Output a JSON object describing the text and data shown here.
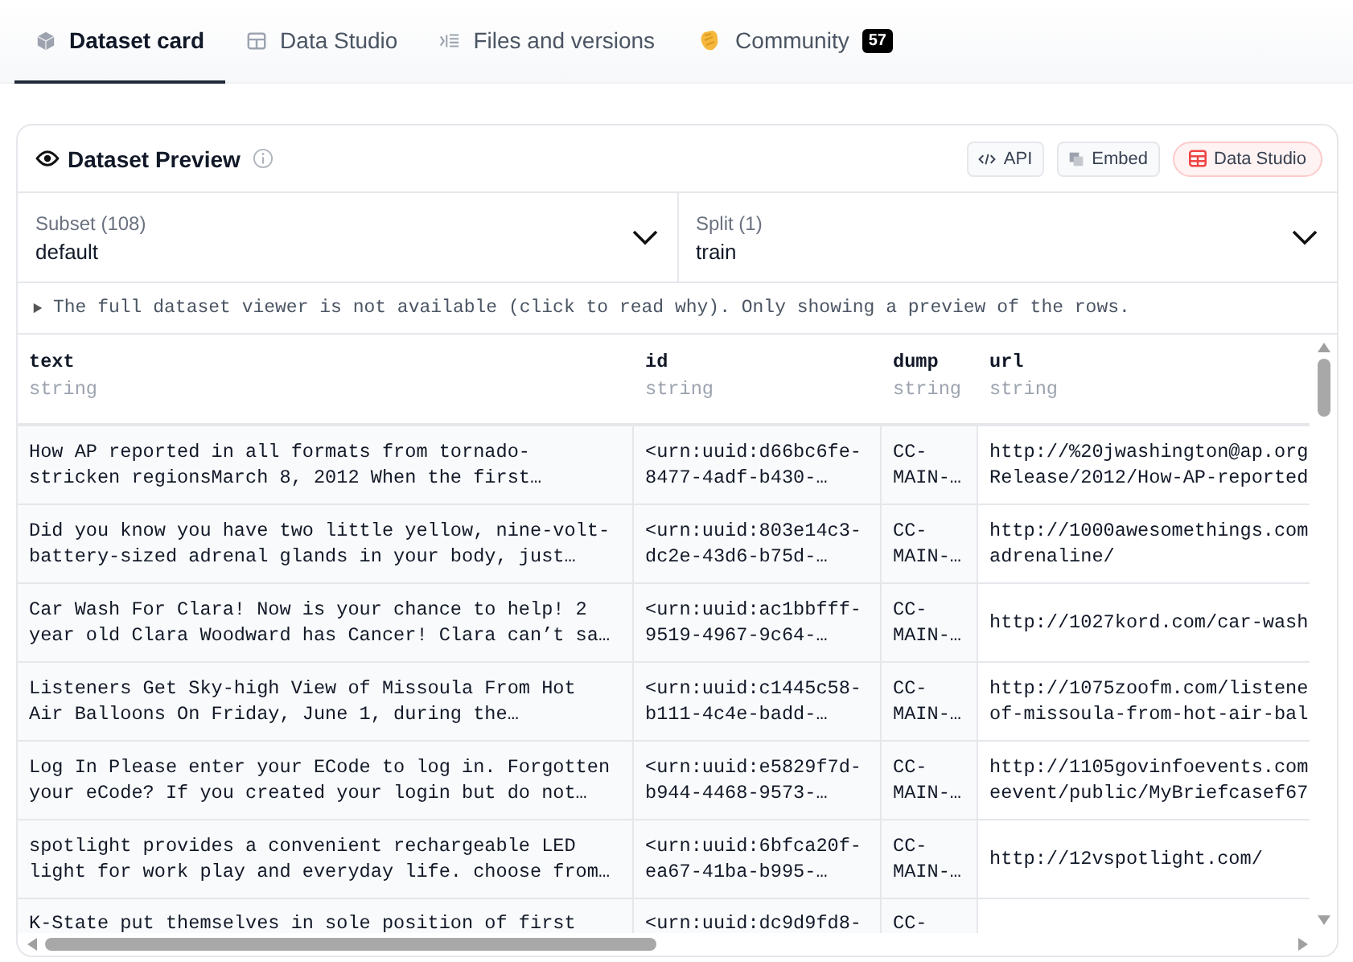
{
  "tabs": [
    {
      "label": "Dataset card",
      "selected": true
    },
    {
      "label": "Data Studio",
      "selected": false
    },
    {
      "label": "Files and versions",
      "selected": false
    },
    {
      "label": "Community",
      "selected": false,
      "badge": "57"
    }
  ],
  "preview": {
    "title": "Dataset Preview",
    "actions": [
      {
        "label": "API",
        "kind": "api"
      },
      {
        "label": "Embed",
        "kind": "embed"
      },
      {
        "label": "Data Studio",
        "kind": "studio"
      }
    ],
    "selects": [
      {
        "label": "Subset (108)",
        "value": "default"
      },
      {
        "label": "Split (1)",
        "value": "train"
      }
    ],
    "notice": "The full dataset viewer is not available (click to read why). Only showing a preview of the rows.",
    "table": {
      "columns": [
        {
          "name": "text",
          "type": "string"
        },
        {
          "name": "id",
          "type": "string"
        },
        {
          "name": "dump",
          "type": "string"
        },
        {
          "name": "url",
          "type": "string"
        }
      ],
      "rows": [
        [
          "How AP reported in all formats from tornado-stricken regionsMarch 8, 2012 When the first…",
          "<urn:uuid:d66bc6fe-8477-4adf-b430-…",
          "CC-MAIN-…",
          "http://%20jwashington@ap.orgRelease/2012/How-AP-reported"
        ],
        [
          "Did you know you have two little yellow, nine-volt-battery-sized adrenal glands in your body, just…",
          "<urn:uuid:803e14c3-dc2e-43d6-b75d-…",
          "CC-MAIN-…",
          "http://1000awesomethings.comadrenaline/"
        ],
        [
          "Car Wash For Clara! Now is your chance to help! 2 year old Clara Woodward has Cancer! Clara can’t sa…",
          "<urn:uuid:ac1bbfff-9519-4967-9c64-…",
          "CC-MAIN-…",
          "http://1027kord.com/car-wash"
        ],
        [
          "Listeners Get Sky-high View of Missoula From Hot Air Balloons On Friday, June 1, during the…",
          "<urn:uuid:c1445c58-b111-4c4e-badd-…",
          "CC-MAIN-…",
          "http://1075zoofm.com/listeneof-missoula-from-hot-air-bal"
        ],
        [
          "Log In Please enter your ECode to log in. Forgotten your eCode? If you created your login but do not…",
          "<urn:uuid:e5829f7d-b944-4468-9573-…",
          "CC-MAIN-…",
          "http://1105govinfoevents.comeevent/public/MyBriefcasef67"
        ],
        [
          "spotlight provides a convenient rechargeable LED light for work play and everyday life. choose from…",
          "<urn:uuid:6bfca20f-ea67-41ba-b995-…",
          "CC-MAIN-…",
          "http://12vspotlight.com/"
        ],
        [
          "K-State put themselves in sole position of first",
          "<urn:uuid:dc9d9fd8-",
          "CC-",
          ""
        ]
      ]
    }
  }
}
